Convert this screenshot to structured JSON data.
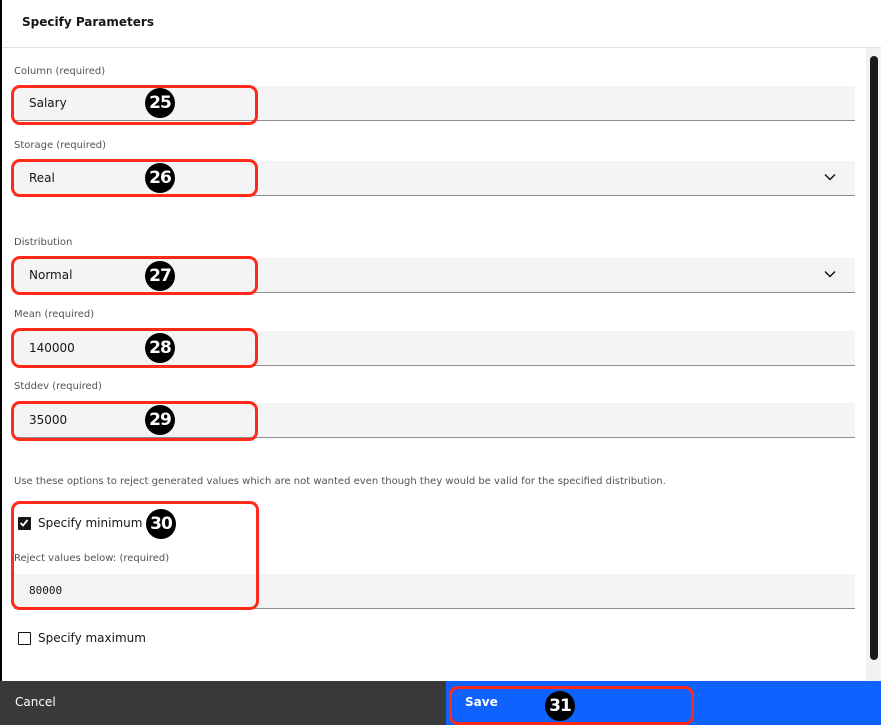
{
  "dialog": {
    "title": "Specify Parameters"
  },
  "fields": {
    "column": {
      "label": "Column (required)",
      "value": "Salary"
    },
    "storage": {
      "label": "Storage (required)",
      "value": "Real"
    },
    "distribution": {
      "label": "Distribution",
      "value": "Normal"
    },
    "mean": {
      "label": "Mean (required)",
      "value": "140000"
    },
    "stddev": {
      "label": "Stddev (required)",
      "value": "35000"
    }
  },
  "help_text": "Use these options to reject generated values which are not wanted even though they would be valid for the specified distribution.",
  "minimum": {
    "checkbox_label": "Specify minimum",
    "checked": true,
    "reject_label": "Reject values below: (required)",
    "reject_value": "80000"
  },
  "maximum": {
    "checkbox_label": "Specify maximum",
    "checked": false
  },
  "footer": {
    "cancel_label": "Cancel",
    "save_label": "Save"
  },
  "annotations": {
    "column": "25",
    "storage": "26",
    "distribution": "27",
    "mean": "28",
    "stddev": "29",
    "minimum": "30",
    "save": "31"
  },
  "colors": {
    "highlight": "#ff2a1a",
    "primary": "#0f62fe",
    "secondary": "#393939"
  },
  "icons": {
    "dropdown": "chevron-down-icon",
    "checkmark": "checkmark-icon"
  }
}
